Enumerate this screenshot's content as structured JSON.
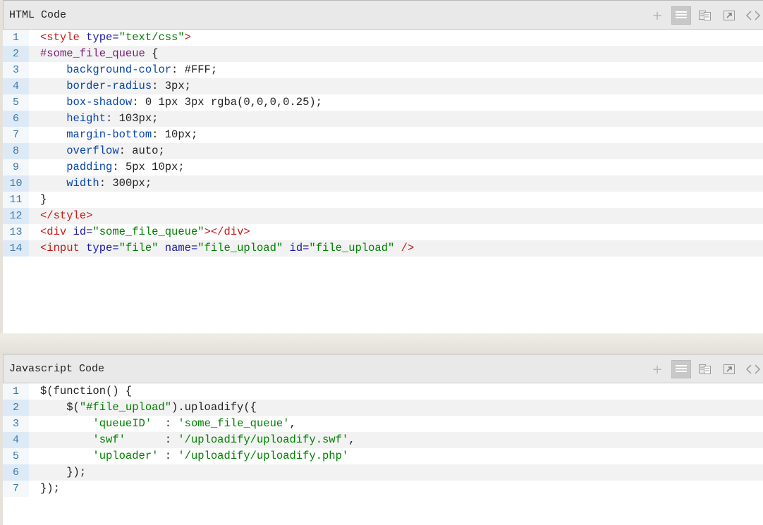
{
  "html_panel": {
    "title": "HTML Code",
    "toolbar": [
      {
        "name": "add-icon",
        "label": "+"
      },
      {
        "name": "view-source-icon"
      },
      {
        "name": "copy-icon"
      },
      {
        "name": "popout-icon"
      },
      {
        "name": "code-icon",
        "label": "<>"
      }
    ],
    "lines": [
      {
        "num": "1",
        "tokens": [
          [
            "tag",
            "<style "
          ],
          [
            "attr",
            "type="
          ],
          [
            "str",
            "\"text/css\""
          ],
          [
            "tag",
            ">"
          ]
        ]
      },
      {
        "num": "2",
        "tokens": [
          [
            "sel",
            "#some_file_queue "
          ],
          [
            "plain",
            "{"
          ]
        ]
      },
      {
        "num": "3",
        "tokens": [
          [
            "plain",
            "    "
          ],
          [
            "prop",
            "background-color"
          ],
          [
            "plain",
            ": #FFF;"
          ]
        ]
      },
      {
        "num": "4",
        "tokens": [
          [
            "plain",
            "    "
          ],
          [
            "prop",
            "border-radius"
          ],
          [
            "plain",
            ": 3px;"
          ]
        ]
      },
      {
        "num": "5",
        "tokens": [
          [
            "plain",
            "    "
          ],
          [
            "prop",
            "box-shadow"
          ],
          [
            "plain",
            ": 0 1px 3px rgba(0,0,0,0.25);"
          ]
        ]
      },
      {
        "num": "6",
        "tokens": [
          [
            "plain",
            "    "
          ],
          [
            "prop",
            "height"
          ],
          [
            "plain",
            ": 103px;"
          ]
        ]
      },
      {
        "num": "7",
        "tokens": [
          [
            "plain",
            "    "
          ],
          [
            "prop",
            "margin-bottom"
          ],
          [
            "plain",
            ": 10px;"
          ]
        ]
      },
      {
        "num": "8",
        "tokens": [
          [
            "plain",
            "    "
          ],
          [
            "prop",
            "overflow"
          ],
          [
            "plain",
            ": auto;"
          ]
        ]
      },
      {
        "num": "9",
        "tokens": [
          [
            "plain",
            "    "
          ],
          [
            "prop",
            "padding"
          ],
          [
            "plain",
            ": 5px 10px;"
          ]
        ]
      },
      {
        "num": "10",
        "tokens": [
          [
            "plain",
            "    "
          ],
          [
            "prop",
            "width"
          ],
          [
            "plain",
            ": 300px;"
          ]
        ]
      },
      {
        "num": "11",
        "tokens": [
          [
            "plain",
            "}"
          ]
        ]
      },
      {
        "num": "12",
        "tokens": [
          [
            "tag",
            "</style>"
          ]
        ]
      },
      {
        "num": "13",
        "tokens": [
          [
            "tag",
            "<div "
          ],
          [
            "attr",
            "id="
          ],
          [
            "str",
            "\"some_file_queue\""
          ],
          [
            "tag",
            "></div>"
          ]
        ]
      },
      {
        "num": "14",
        "tokens": [
          [
            "tag",
            "<input "
          ],
          [
            "attr",
            "type="
          ],
          [
            "str",
            "\"file\" "
          ],
          [
            "attr",
            "name="
          ],
          [
            "str",
            "\"file_upload\" "
          ],
          [
            "attr",
            "id="
          ],
          [
            "str",
            "\"file_upload\" "
          ],
          [
            "tag",
            "/>"
          ]
        ]
      }
    ]
  },
  "js_panel": {
    "title": "Javascript Code",
    "toolbar": [
      {
        "name": "add-icon",
        "label": "+"
      },
      {
        "name": "view-source-icon"
      },
      {
        "name": "copy-icon"
      },
      {
        "name": "popout-icon"
      },
      {
        "name": "code-icon",
        "label": "<>"
      }
    ],
    "lines": [
      {
        "num": "1",
        "tokens": [
          [
            "plain",
            "$(function() {"
          ]
        ]
      },
      {
        "num": "2",
        "tokens": [
          [
            "plain",
            "    $("
          ],
          [
            "str",
            "\"#file_upload\""
          ],
          [
            "plain",
            ").uploadify({"
          ]
        ]
      },
      {
        "num": "3",
        "tokens": [
          [
            "plain",
            "        "
          ],
          [
            "str",
            "'queueID'"
          ],
          [
            "plain",
            "  : "
          ],
          [
            "str",
            "'some_file_queue'"
          ],
          [
            "plain",
            ","
          ]
        ]
      },
      {
        "num": "4",
        "tokens": [
          [
            "plain",
            "        "
          ],
          [
            "str",
            "'swf'"
          ],
          [
            "plain",
            "      : "
          ],
          [
            "str",
            "'/uploadify/uploadify.swf'"
          ],
          [
            "plain",
            ","
          ]
        ]
      },
      {
        "num": "5",
        "tokens": [
          [
            "plain",
            "        "
          ],
          [
            "str",
            "'uploader'"
          ],
          [
            "plain",
            " : "
          ],
          [
            "str",
            "'/uploadify/uploadify.php'"
          ]
        ]
      },
      {
        "num": "6",
        "tokens": [
          [
            "plain",
            "    });"
          ]
        ]
      },
      {
        "num": "7",
        "tokens": [
          [
            "plain",
            "});"
          ]
        ]
      }
    ]
  }
}
